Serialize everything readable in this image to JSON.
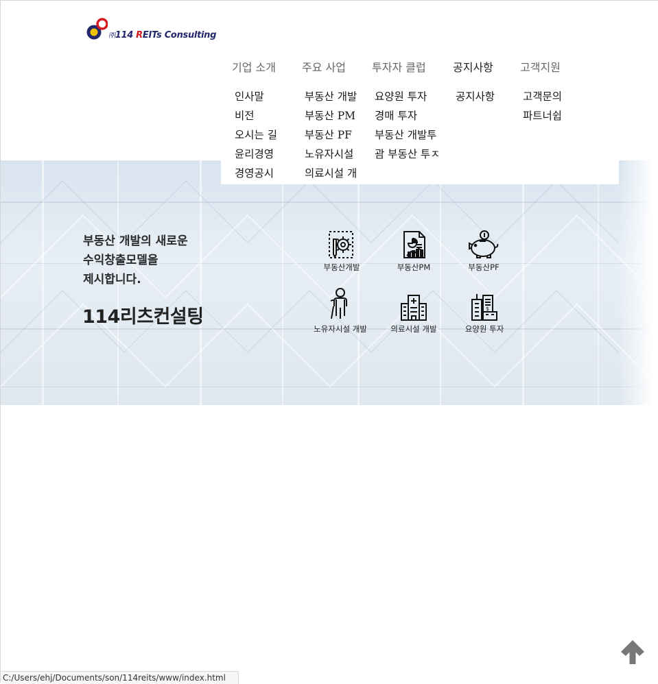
{
  "logo": {
    "corp_mark": "㈜",
    "name_prefix": "114 ",
    "name_r": "R",
    "name_rest": "EITs Consulting"
  },
  "nav": {
    "top": [
      "기업 소개",
      "주요 사업",
      "투자자 클럽",
      "공지사항",
      "고객지원"
    ],
    "columns": [
      [
        "인사말",
        "비전",
        "오시는 길",
        "윤리경영",
        "경영공시"
      ],
      [
        "부동산 개발",
        "부동산 PM",
        "부동산 PF",
        "노유자시설",
        "의료시설 개"
      ],
      [
        "요양원 투자",
        "경매 투자",
        "부동산 개발투",
        "괌 부동산 투ㅈ"
      ],
      [
        "공지사항"
      ],
      [
        "고객문의",
        "파트너쉽"
      ]
    ]
  },
  "hero": {
    "slogan": [
      "부동산 개발의 새로운",
      "수익창출모델을",
      "제시합니다."
    ],
    "brand": "114리츠컨설팅",
    "services": [
      {
        "label": "부동산개발",
        "icon": "gear-document-icon"
      },
      {
        "label": "부동산PM",
        "icon": "report-chart-icon"
      },
      {
        "label": "부동산PF",
        "icon": "piggy-bank-icon"
      },
      {
        "label": "노유자시설  개발",
        "icon": "elderly-person-icon"
      },
      {
        "label": "의료시설  개발",
        "icon": "hospital-icon"
      },
      {
        "label": "요양원  투자",
        "icon": "buildings-icon"
      }
    ]
  },
  "status_bar": {
    "url": "C:/Users/ehj/Documents/son/114reits/www/index.html"
  },
  "colors": {
    "logo_blue": "#23286e",
    "logo_red": "#d41a1f",
    "logo_yellow": "#f2c200",
    "arrow_gray": "#777777"
  }
}
